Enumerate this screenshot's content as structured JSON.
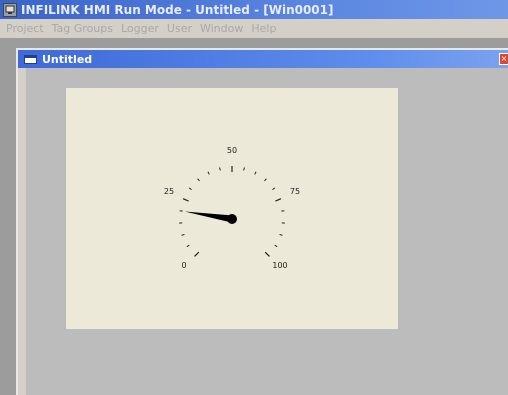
{
  "window": {
    "title": "INFILINK HMI Run Mode - Untitled - [Win0001]",
    "icon": "app-icon"
  },
  "menu": [
    "Project",
    "Tag Groups",
    "Logger",
    "User",
    "Window",
    "Help"
  ],
  "child_window": {
    "title": "Untitled",
    "icon": "window-icon",
    "close_label": "×"
  },
  "gauge": {
    "min": 0,
    "max": 100,
    "value": 20,
    "labels": [
      "0",
      "25",
      "50",
      "75",
      "100"
    ],
    "colors": {
      "needle": "#000000",
      "face": "#ece9d8",
      "ticks": "#222222"
    }
  }
}
